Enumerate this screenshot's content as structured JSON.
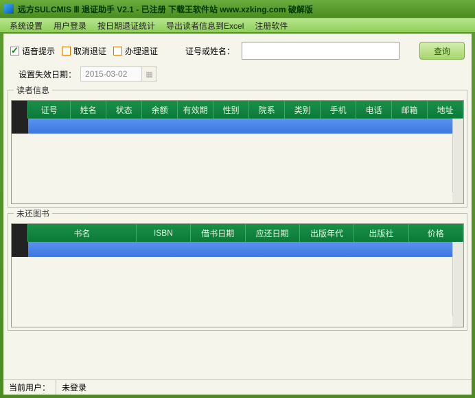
{
  "window": {
    "title": "远方SULCMIS Ⅲ 退证助手 V2.1 - 已注册  下载王软件站 www.xzking.com 破解版"
  },
  "menu": {
    "items": [
      "系统设置",
      "用户登录",
      "按日期退证统计",
      "导出读者信息到Excel",
      "注册软件"
    ]
  },
  "toolbar": {
    "voice_prompt": {
      "label": "语音提示",
      "checked": true
    },
    "cancel_withdraw": {
      "label": "取消退证",
      "checked": false
    },
    "process_withdraw": {
      "label": "办理退证",
      "checked": false
    },
    "search_label": "证号或姓名：",
    "search_value": "",
    "query_button": "查询"
  },
  "expiry": {
    "label": "设置失效日期：",
    "value": "2015-03-02"
  },
  "reader_box": {
    "legend": "读者信息",
    "columns": [
      "证号",
      "姓名",
      "状态",
      "余额",
      "有效期",
      "性别",
      "院系",
      "类别",
      "手机",
      "电话",
      "邮箱",
      "地址"
    ],
    "rows": []
  },
  "books_box": {
    "legend": "未还图书",
    "columns": [
      "书名",
      "ISBN",
      "借书日期",
      "应还日期",
      "出版年代",
      "出版社",
      "价格"
    ],
    "rows": []
  },
  "status": {
    "user_label": "当前用户：",
    "user_value": "未登录"
  }
}
